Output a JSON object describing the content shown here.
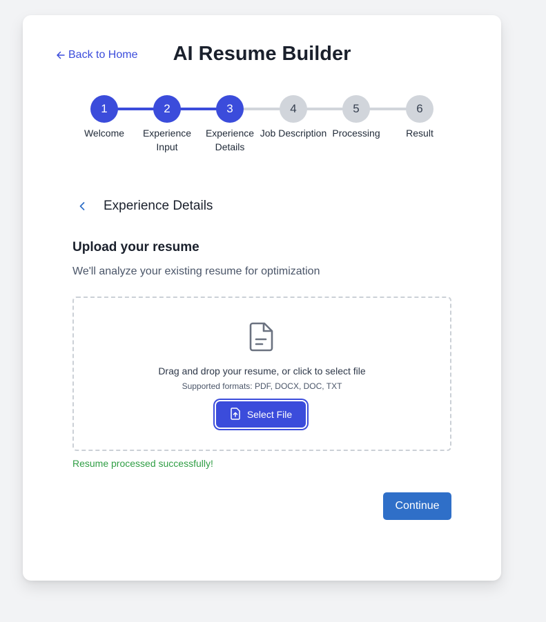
{
  "header": {
    "back_label": "Back to Home",
    "title": "AI Resume Builder"
  },
  "stepper": {
    "current_step": 3,
    "steps": [
      {
        "number": "1",
        "label": "Welcome"
      },
      {
        "number": "2",
        "label": "Experience Input"
      },
      {
        "number": "3",
        "label": "Experience Details"
      },
      {
        "number": "4",
        "label": "Job Description"
      },
      {
        "number": "5",
        "label": "Processing"
      },
      {
        "number": "6",
        "label": "Result"
      }
    ]
  },
  "section": {
    "title": "Experience Details",
    "back_icon": "chevron-left-icon"
  },
  "upload": {
    "title": "Upload your resume",
    "description": "We'll analyze your existing resume for optimization",
    "drop_text": "Drag and drop your resume, or click to select file",
    "formats_text": "Supported formats: PDF, DOCX, DOC, TXT",
    "select_label": "Select File",
    "file_icon": "document-icon",
    "button_icon": "file-upload-icon"
  },
  "status": {
    "message": "Resume processed successfully!"
  },
  "footer": {
    "continue_label": "Continue"
  },
  "colors": {
    "accent": "#3b4cdb",
    "step_inactive": "#d1d5db",
    "success": "#2f9e44",
    "continue": "#2f6fc8",
    "background": "#f2f3f5"
  }
}
